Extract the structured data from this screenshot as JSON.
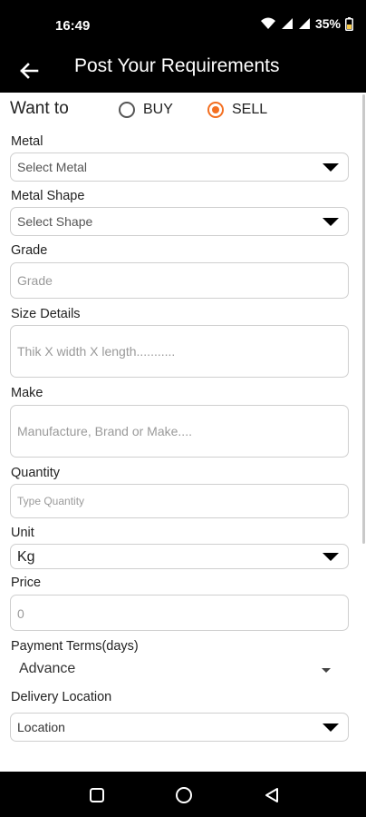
{
  "status_bar": {
    "time": "16:49",
    "battery": "35%",
    "icons": [
      "wifi-icon",
      "signal-icon",
      "signal-icon",
      "battery-icon"
    ]
  },
  "app_bar": {
    "back_icon": "arrow-left-icon",
    "title": "Post Your Requirements"
  },
  "form": {
    "want_to": {
      "label": "Want to",
      "options": [
        "BUY",
        "SELL"
      ],
      "selected": "SELL"
    },
    "metal": {
      "label": "Metal",
      "value": "Select Metal"
    },
    "metal_shape": {
      "label": "Metal Shape",
      "value": "Select Shape"
    },
    "grade": {
      "label": "Grade",
      "placeholder": "Grade"
    },
    "size_details": {
      "label": "Size Details",
      "placeholder": "Thik X width X length..........."
    },
    "make": {
      "label": "Make",
      "placeholder": "Manufacture, Brand or Make...."
    },
    "quantity": {
      "label": "Quantity",
      "placeholder": "Type Quantity"
    },
    "unit": {
      "label": "Unit",
      "value": "Kg"
    },
    "price": {
      "label": "Price",
      "placeholder": "0"
    },
    "payment_terms": {
      "label": "Payment Terms(days)",
      "value": "Advance"
    },
    "delivery_location": {
      "label": "Delivery Location",
      "value": "Location"
    }
  },
  "colors": {
    "accent": "#f36f21",
    "bar_background": "#000000",
    "field_border": "#cfcfcf"
  },
  "nav_bar": {
    "icons": [
      "recents-square-icon",
      "home-circle-icon",
      "back-triangle-icon"
    ]
  }
}
